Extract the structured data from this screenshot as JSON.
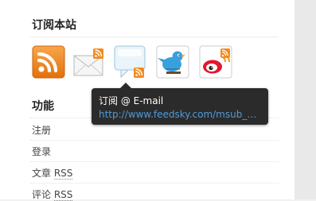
{
  "subscribe": {
    "title": "订阅本站",
    "icons": [
      {
        "name": "rss-feed-icon"
      },
      {
        "name": "email-subscribe-icon"
      },
      {
        "name": "chat-bubble-rss-icon"
      },
      {
        "name": "twitter-bird-icon"
      },
      {
        "name": "weibo-icon"
      }
    ]
  },
  "tooltip": {
    "title": "订阅 @ E-mail",
    "url": "http://www.feedsky.com/msub_wr..."
  },
  "functions": {
    "title": "功能",
    "items": [
      {
        "label": "注册"
      },
      {
        "label": "登录"
      },
      {
        "label": "文章",
        "suffix": "RSS"
      },
      {
        "label": "评论",
        "suffix": "RSS"
      }
    ]
  },
  "colors": {
    "rss_orange": "#f48a1d",
    "tooltip_bg": "#2b2b2b",
    "tooltip_link": "#4f9bd8",
    "twitter_blue": "#3aa0dc",
    "weibo_red": "#e6162d"
  }
}
